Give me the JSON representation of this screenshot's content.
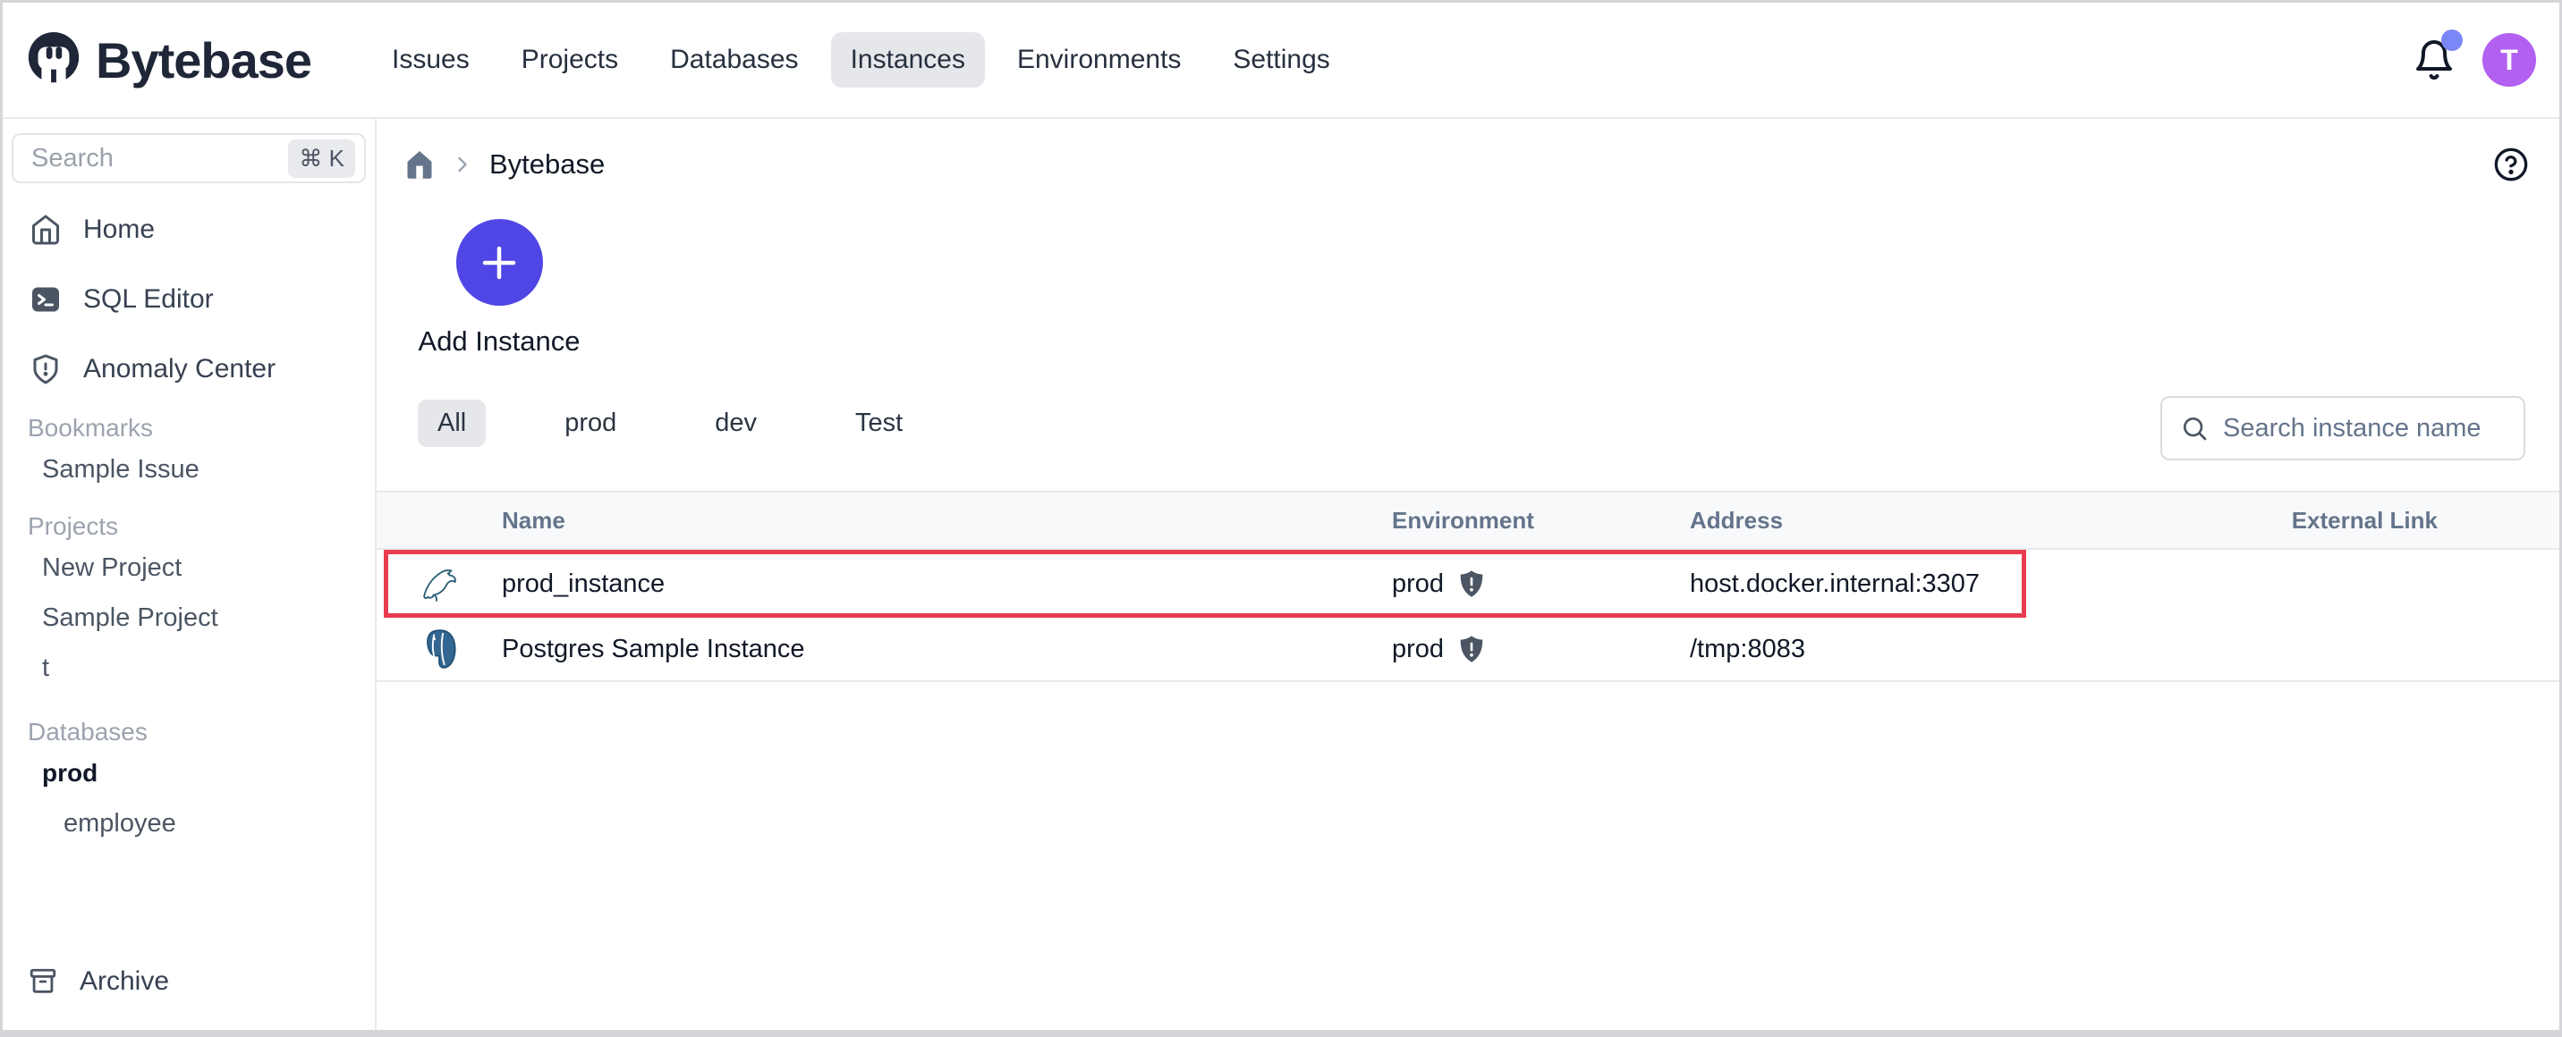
{
  "navbar": {
    "logo_text": "Bytebase",
    "items": [
      {
        "label": "Issues",
        "active": false
      },
      {
        "label": "Projects",
        "active": false
      },
      {
        "label": "Databases",
        "active": false
      },
      {
        "label": "Instances",
        "active": true
      },
      {
        "label": "Environments",
        "active": false
      },
      {
        "label": "Settings",
        "active": false
      }
    ],
    "avatar_letter": "T"
  },
  "sidebar": {
    "search_placeholder": "Search",
    "search_shortcut": "⌘ K",
    "nav_items": [
      {
        "label": "Home",
        "icon": "home-icon"
      },
      {
        "label": "SQL Editor",
        "icon": "terminal-icon"
      },
      {
        "label": "Anomaly Center",
        "icon": "shield-alert-icon"
      }
    ],
    "sections": [
      {
        "title": "Bookmarks",
        "items": [
          {
            "label": "Sample Issue"
          }
        ]
      },
      {
        "title": "Projects",
        "items": [
          {
            "label": "New Project"
          },
          {
            "label": "Sample Project"
          },
          {
            "label": "t"
          }
        ]
      },
      {
        "title": "Databases",
        "items": [
          {
            "label": "prod"
          },
          {
            "label": "employee"
          }
        ]
      }
    ],
    "archive_label": "Archive"
  },
  "main": {
    "breadcrumb_current": "Bytebase",
    "add_instance_label": "Add Instance",
    "filter_tabs": [
      {
        "label": "All",
        "active": true
      },
      {
        "label": "prod",
        "active": false
      },
      {
        "label": "dev",
        "active": false
      },
      {
        "label": "Test",
        "active": false
      }
    ],
    "search_placeholder": "Search instance name",
    "table": {
      "columns": [
        "Name",
        "Environment",
        "Address",
        "External Link"
      ],
      "rows": [
        {
          "engine": "mysql",
          "name": "prod_instance",
          "environment": "prod",
          "address": "host.docker.internal:3307",
          "external_link": "",
          "highlighted": true
        },
        {
          "engine": "postgresql",
          "name": "Postgres Sample Instance",
          "environment": "prod",
          "address": "/tmp:8083",
          "external_link": "",
          "highlighted": false
        }
      ]
    }
  },
  "colors": {
    "accent_indigo": "#4f46e5",
    "avatar_purple": "#b160f0",
    "notification_badge": "#7b87f7",
    "highlight_red": "#e93c4e",
    "logo_navy": "#1f2637",
    "active_pill_bg": "#e5e7ea"
  }
}
